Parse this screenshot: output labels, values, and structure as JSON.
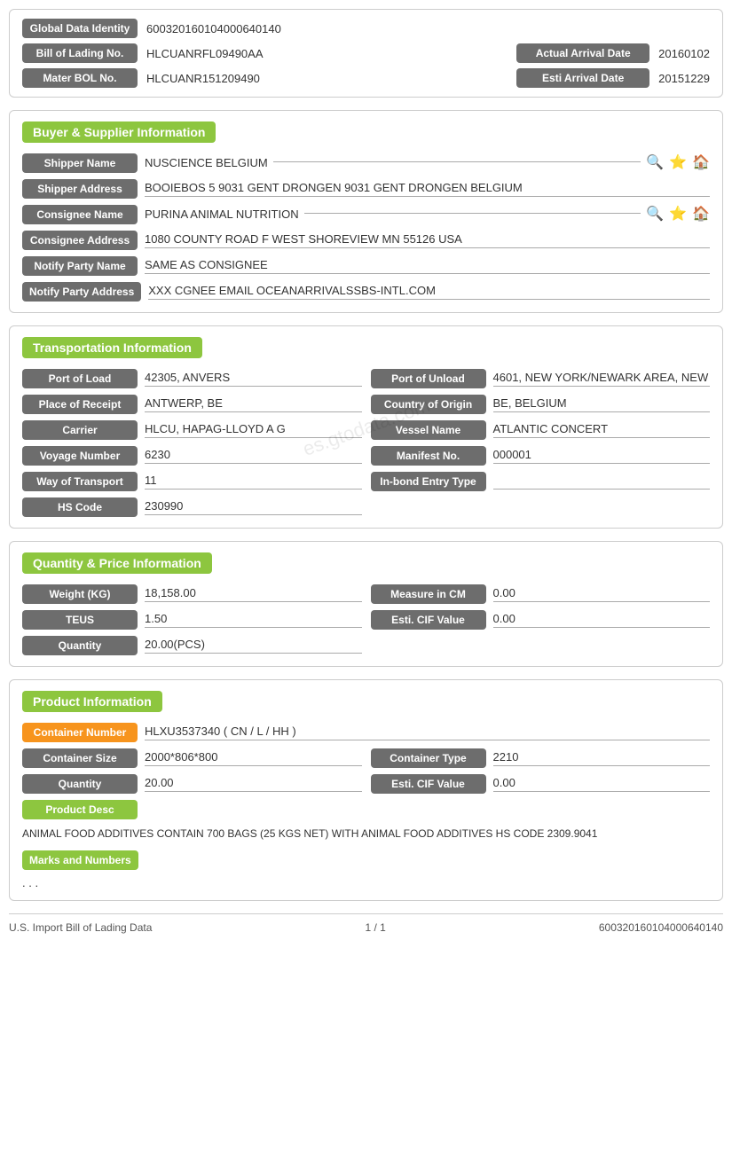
{
  "header": {
    "global_data_identity_label": "Global Data Identity",
    "global_data_identity_value": "600320160104000640140",
    "bill_of_lading_label": "Bill of Lading No.",
    "bill_of_lading_value": "HLCUANRFL09490AA",
    "actual_arrival_date_label": "Actual Arrival Date",
    "actual_arrival_date_value": "20160102",
    "mater_bol_label": "Mater BOL No.",
    "mater_bol_value": "HLCUANR151209490",
    "esti_arrival_label": "Esti Arrival Date",
    "esti_arrival_value": "20151229"
  },
  "buyer_supplier": {
    "section_title": "Buyer & Supplier Information",
    "shipper_name_label": "Shipper Name",
    "shipper_name_value": "NUSCIENCE BELGIUM",
    "shipper_address_label": "Shipper Address",
    "shipper_address_value": "BOOIEBOS 5 9031 GENT DRONGEN 9031 GENT DRONGEN BELGIUM",
    "consignee_name_label": "Consignee Name",
    "consignee_name_value": "PURINA ANIMAL NUTRITION",
    "consignee_address_label": "Consignee Address",
    "consignee_address_value": "1080 COUNTY ROAD F WEST SHOREVIEW MN 55126 USA",
    "notify_party_name_label": "Notify Party Name",
    "notify_party_name_value": "SAME AS CONSIGNEE",
    "notify_party_address_label": "Notify Party Address",
    "notify_party_address_value": "XXX CGNEE EMAIL OCEANARRIVALSSBS-INTL.COM"
  },
  "transportation": {
    "section_title": "Transportation Information",
    "port_of_load_label": "Port of Load",
    "port_of_load_value": "42305, ANVERS",
    "port_of_unload_label": "Port of Unload",
    "port_of_unload_value": "4601, NEW YORK/NEWARK AREA, NEW",
    "place_of_receipt_label": "Place of Receipt",
    "place_of_receipt_value": "ANTWERP, BE",
    "country_of_origin_label": "Country of Origin",
    "country_of_origin_value": "BE, BELGIUM",
    "carrier_label": "Carrier",
    "carrier_value": "HLCU, HAPAG-LLOYD A G",
    "vessel_name_label": "Vessel Name",
    "vessel_name_value": "ATLANTIC CONCERT",
    "voyage_number_label": "Voyage Number",
    "voyage_number_value": "6230",
    "manifest_no_label": "Manifest No.",
    "manifest_no_value": "000001",
    "way_of_transport_label": "Way of Transport",
    "way_of_transport_value": "11",
    "in_bond_entry_label": "In-bond Entry Type",
    "in_bond_entry_value": "",
    "hs_code_label": "HS Code",
    "hs_code_value": "230990"
  },
  "quantity_price": {
    "section_title": "Quantity & Price Information",
    "weight_label": "Weight (KG)",
    "weight_value": "18,158.00",
    "measure_label": "Measure in CM",
    "measure_value": "0.00",
    "teus_label": "TEUS",
    "teus_value": "1.50",
    "esti_cif_label": "Esti. CIF Value",
    "esti_cif_value": "0.00",
    "quantity_label": "Quantity",
    "quantity_value": "20.00(PCS)"
  },
  "product": {
    "section_title": "Product Information",
    "container_number_label": "Container Number",
    "container_number_value": "HLXU3537340 ( CN / L / HH )",
    "container_size_label": "Container Size",
    "container_size_value": "2000*806*800",
    "container_type_label": "Container Type",
    "container_type_value": "2210",
    "quantity_label": "Quantity",
    "quantity_value": "20.00",
    "esti_cif_label": "Esti. CIF Value",
    "esti_cif_value": "0.00",
    "product_desc_label": "Product Desc",
    "product_desc_value": "ANIMAL FOOD ADDITIVES CONTAIN 700 BAGS (25 KGS NET) WITH ANIMAL FOOD ADDITIVES HS CODE 2309.9041",
    "marks_label": "Marks and Numbers",
    "marks_value": ". . ."
  },
  "footer": {
    "left": "U.S. Import Bill of Lading Data",
    "center": "1 / 1",
    "right": "600320160104000640140"
  },
  "watermark": "es.gtodata.com"
}
